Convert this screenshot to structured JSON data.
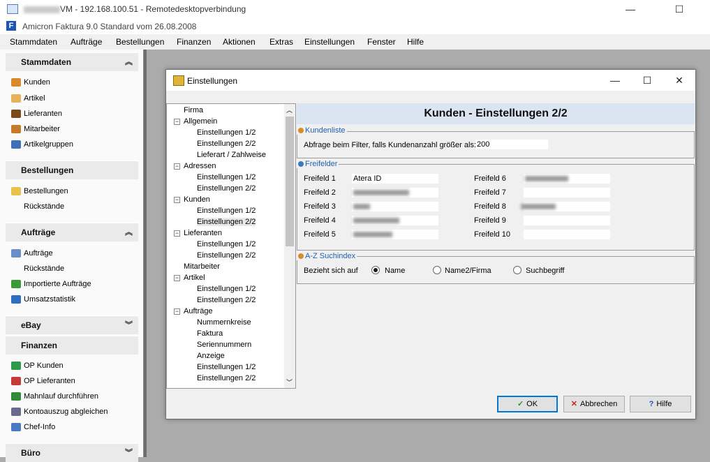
{
  "rdp": {
    "title_suffix": "VM - 192.168.100.51 - Remotedesktopverbindung",
    "minimize": "—",
    "maximize": "☐"
  },
  "app": {
    "title": "Amicron Faktura 9.0 Standard vom 26.08.2008",
    "icon_letter": "F"
  },
  "menu": [
    "Stammdaten",
    "Aufträge",
    "Bestellungen",
    "Finanzen",
    "Aktionen",
    "Extras",
    "Einstellungen",
    "Fenster",
    "Hilfe"
  ],
  "left": {
    "stammdaten": {
      "title": "Stammdaten",
      "items": [
        "Kunden",
        "Artikel",
        "Lieferanten",
        "Mitarbeiter",
        "Artikelgruppen"
      ]
    },
    "bestellungen": {
      "title": "Bestellungen",
      "items": [
        "Bestellungen",
        "Rückstände"
      ]
    },
    "auftraege": {
      "title": "Aufträge",
      "items": [
        "Aufträge",
        "Rückstände",
        "Importierte Aufträge",
        "Umsatzstatistik"
      ]
    },
    "ebay": {
      "title": "eBay"
    },
    "finanzen": {
      "title": "Finanzen",
      "items": [
        "OP Kunden",
        "OP Lieferanten",
        "Mahnlauf durchführen",
        "Kontoauszug abgleichen",
        "Chef-Info"
      ]
    },
    "buero": {
      "title": "Büro"
    },
    "chev_up": "≈",
    "chev_down": "≈"
  },
  "dialog": {
    "title": "Einstellungen",
    "header": "Kunden - Einstellungen 2/2",
    "tree": {
      "firma": "Firma",
      "allgemein": "Allgemein",
      "allgemein_items": [
        "Einstellungen 1/2",
        "Einstellungen 2/2",
        "Lieferart / Zahlweise"
      ],
      "adressen": "Adressen",
      "adressen_items": [
        "Einstellungen 1/2",
        "Einstellungen 2/2"
      ],
      "kunden": "Kunden",
      "kunden_items": [
        "Einstellungen 1/2",
        "Einstellungen 2/2"
      ],
      "lieferanten": "Lieferanten",
      "lieferanten_items": [
        "Einstellungen 1/2",
        "Einstellungen 2/2"
      ],
      "mitarbeiter": "Mitarbeiter",
      "artikel": "Artikel",
      "artikel_items": [
        "Einstellungen 1/2",
        "Einstellungen 2/2"
      ],
      "auftraege": "Aufträge",
      "auftraege_items": [
        "Nummernkreise",
        "Faktura",
        "Seriennummern",
        "Anzeige",
        "Einstellungen 1/2",
        "Einstellungen 2/2"
      ]
    },
    "kundenliste": {
      "title": "Kundenliste",
      "label": "Abfrage beim Filter, falls Kundenanzahl größer als:",
      "value": "200"
    },
    "freifelder": {
      "title": "Freifelder",
      "labels": [
        "Freifeld 1",
        "Freifeld 2",
        "Freifeld 3",
        "Freifeld 4",
        "Freifeld 5",
        "Freifeld 6",
        "Freifeld 7",
        "Freifeld 8",
        "Freifeld 9",
        "Freifeld 10"
      ],
      "freifeld1_value": "Atera ID"
    },
    "suchindex": {
      "title": "A-Z Suchindex",
      "label": "Bezieht sich auf",
      "options": [
        "Name",
        "Name2/Firma",
        "Suchbegriff"
      ],
      "selected": "Name"
    },
    "buttons": {
      "ok": "OK",
      "abbrechen": "Abbrechen",
      "hilfe": "Hilfe"
    }
  },
  "colors": {
    "accent": "#0078d7",
    "header_bg": "#dbe5f1",
    "group_label": "#2060b0"
  }
}
